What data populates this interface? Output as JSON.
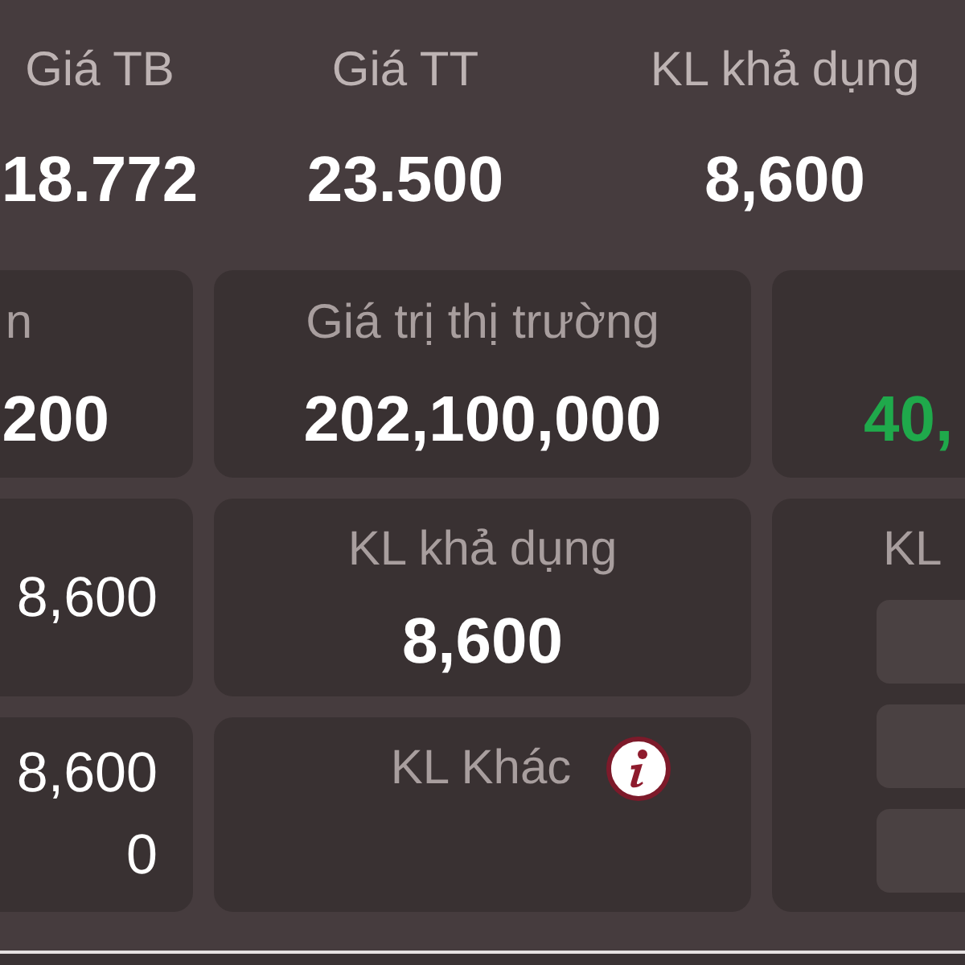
{
  "summary": [
    {
      "label": "Giá TB",
      "value": "18.772"
    },
    {
      "label": "Giá TT",
      "value": "23.500"
    },
    {
      "label": "KL khả dụng",
      "value": "8,600"
    }
  ],
  "metric_cards": [
    {
      "label": "n",
      "value": "200",
      "gain": false
    },
    {
      "label": "Giá trị thị trường",
      "value": "202,100,000",
      "gain": false
    },
    {
      "value": "40,",
      "gain": true
    }
  ],
  "left_cards": [
    {
      "values": [
        "8,600"
      ]
    },
    {
      "values": [
        "8,600",
        "0"
      ]
    }
  ],
  "middle_cards": [
    {
      "label": "KL khả dụng",
      "value": "8,600"
    },
    {
      "label": "KL Khác",
      "info_button": true
    }
  ],
  "right_panel": {
    "label": "KL"
  }
}
